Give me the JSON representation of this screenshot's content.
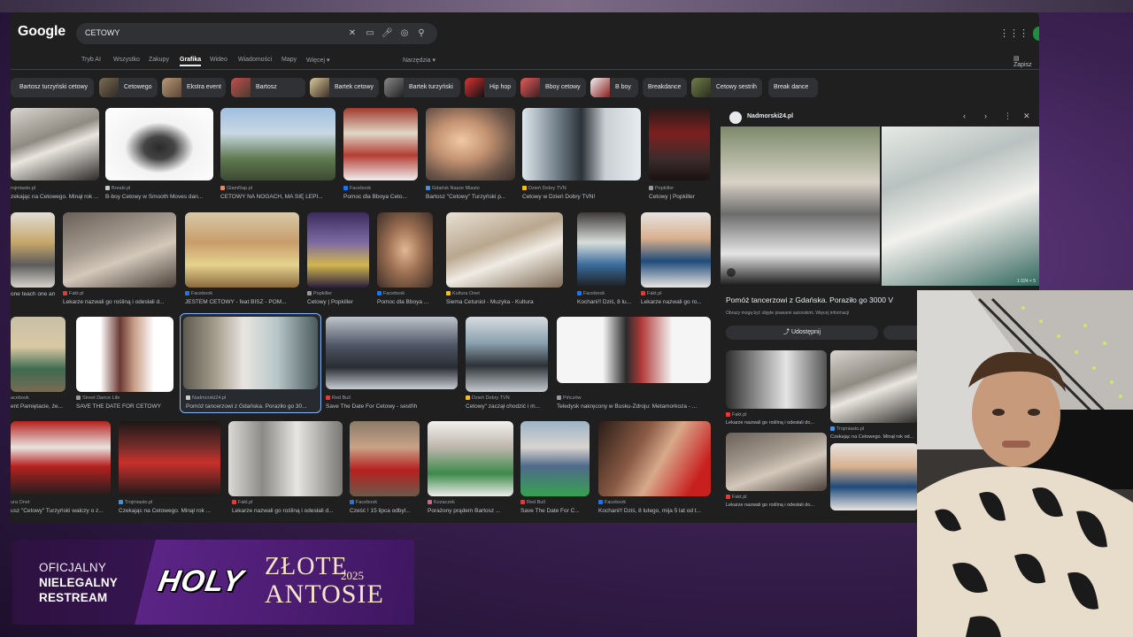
{
  "search": {
    "logo": "Google",
    "query": "CETOWY"
  },
  "tabs": [
    {
      "label": "Tryb AI"
    },
    {
      "label": "Wszystko"
    },
    {
      "label": "Zakupy"
    },
    {
      "label": "Grafika"
    },
    {
      "label": "Wideo"
    },
    {
      "label": "Wiadomości"
    },
    {
      "label": "Mapy"
    },
    {
      "label": "Więcej ▾"
    }
  ],
  "tools_label": "Narzędzia ▾",
  "save_label": "Zapisz",
  "chips": [
    "Bartosz turzyński cetowy",
    "Cetowego",
    "Ekstra event",
    "Bartosz",
    "Bartek cetowy",
    "Bartek turzyński",
    "Hip hop",
    "Bboy cetowy",
    "B boy",
    "Breakdance",
    "Cetowy sestrih",
    "Break dance"
  ],
  "results": [
    {
      "source": "rojmiasto.pl",
      "title": "zekając na Cetowego. Minął rok ..."
    },
    {
      "source": "Breaki.pl",
      "title": "B-boy Cetowy w Smooth Moves dan..."
    },
    {
      "source": "GlamRap.pl",
      "title": "CETOWY NA NOGACH, MA SIĘ LEPI..."
    },
    {
      "source": "Facebook",
      "title": "Pomoc dla Bboya Ceto..."
    },
    {
      "source": "Gdańsk Nasze Miasto",
      "title": "Bartosz \"Cetowy\" Turzyński p..."
    },
    {
      "source": "Dzień Dobry TVN",
      "title": "Cetowy w Dzień Dobry TVN!"
    },
    {
      "source": "Popkiller",
      "title": "Cetowy | Popkiller"
    },
    {
      "source": "",
      "title": "one teach one and support f..."
    },
    {
      "source": "Fakt.pl",
      "title": "Lekarze nazwali go rośliną i odesłali d..."
    },
    {
      "source": "Facebook",
      "title": "JESTEM CETOWY - feat BISZ - POM..."
    },
    {
      "source": "Popkiller",
      "title": "Cetowy | Popkiller"
    },
    {
      "source": "Facebook",
      "title": "Pomoc dla Bboya ..."
    },
    {
      "source": "Kultura Onet",
      "title": "Siema Cetuniol - Muzyka - Kultura"
    },
    {
      "source": "Facebook",
      "title": "Kochani!! Dziś, 8 lu..."
    },
    {
      "source": "Fakt.pl",
      "title": "Lekarze nazwali go ro..."
    },
    {
      "source": "acebook",
      "title": "ent Pamiętacie, że..."
    },
    {
      "source": "Street Dance Life",
      "title": "SAVE THE DATE FOR CETOWY"
    },
    {
      "source": "Nadmorski24.pl",
      "title": "Pomóż tancerzowi z Gdańska. Poraziło go 30..."
    },
    {
      "source": "Red Bull",
      "title": "Save The Date For Cetowy - sestřih"
    },
    {
      "source": "Dzień Dobry TVN",
      "title": "Cetowy\" zaczął chodzić i m..."
    },
    {
      "source": "Pińczów",
      "title": "Teledysk nakręcony w Busku-Zdroju: Metamorkoza - ..."
    },
    {
      "source": "ura Onet",
      "title": "usz \"Cetowy\" Turzyński walczy o z..."
    },
    {
      "source": "Trojmiasto.pl",
      "title": "Czekając na Cetowego. Minął rok ..."
    },
    {
      "source": "Fakt.pl",
      "title": "Lekarze nazwali go rośliną i odesłali d..."
    },
    {
      "source": "Facebook",
      "title": "Cześć ! 15 lipca odbyl..."
    },
    {
      "source": "Kozaczek",
      "title": "Porażony prądem Bartosz ..."
    },
    {
      "source": "Red Bull",
      "title": "Save The Date For C..."
    },
    {
      "source": "Facebook",
      "title": "Kochani!! Dziś, 8 lutego, mija 5 lat od t..."
    }
  ],
  "preview": {
    "site": "Nadmorski24.pl",
    "title": "Pomóż tancerzowi z Gdańska. Poraziło go 3000 V",
    "note": "Obrazy mogą być objęte prawami autorskimi. Więcej informacji",
    "share_label": "Udostępnij",
    "resolution": "1 024 × 5",
    "related": [
      {
        "source": "Fakt.pl",
        "title": "Lekarze nazwali go rośliną i odesłali do..."
      },
      {
        "source": "Trojmiasto.pl",
        "title": "Czekając na Cetowego. Minął rok od..."
      },
      {
        "source": "Fakt.pl",
        "title": "Lekarze nazwali go rośliną i odesłali do..."
      }
    ]
  },
  "overlay": {
    "line1": "OFICJALNY",
    "line2": "NIELEGALNY",
    "line3": "RESTREAM",
    "brand": "HOLY",
    "event_top": "ZŁOTE",
    "event_year": "2025",
    "event_bottom": "ANTOSIE"
  },
  "colors": {
    "window_bg": "#1f1f1f",
    "search_bg": "#303134",
    "accent_blue": "#8ab4f8",
    "stream_purple": "#3b1558"
  },
  "icons": [
    "close-icon",
    "keyboard-icon",
    "mic-icon",
    "lens-icon",
    "search-icon",
    "apps-icon",
    "share-icon",
    "bookmark-icon",
    "chevron-left-icon",
    "chevron-right-icon",
    "more-icon"
  ]
}
